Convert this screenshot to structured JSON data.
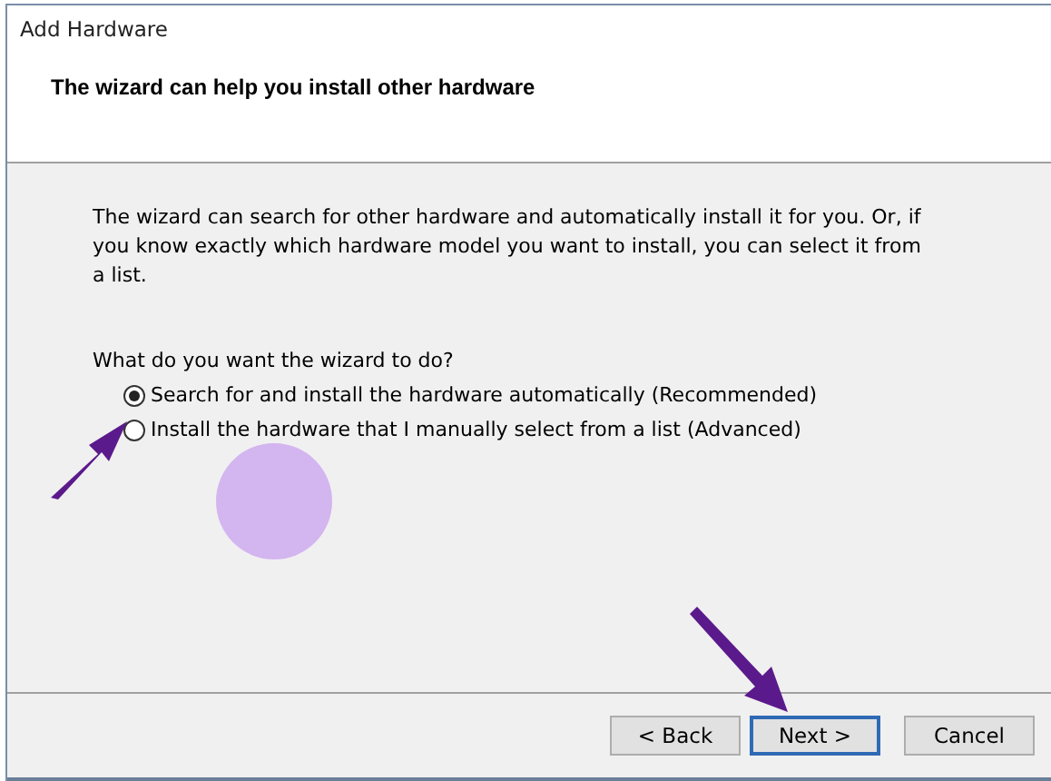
{
  "window": {
    "title": "Add Hardware"
  },
  "header": {
    "title": "The wizard can help you install other hardware"
  },
  "description": "The wizard can search for other hardware and automatically install it for you. Or, if you know exactly which hardware model you want to install, you can select it from a list.",
  "question": "What do you want the wizard to do?",
  "options": [
    {
      "label": "Search for and install the hardware automatically (Recommended)",
      "selected": true
    },
    {
      "label": "Install the hardware that I manually select from a list (Advanced)",
      "selected": false
    }
  ],
  "buttons": [
    {
      "label": "< Back",
      "focused": false
    },
    {
      "label": "Next >",
      "focused": true
    },
    {
      "label": "Cancel",
      "focused": false
    }
  ]
}
